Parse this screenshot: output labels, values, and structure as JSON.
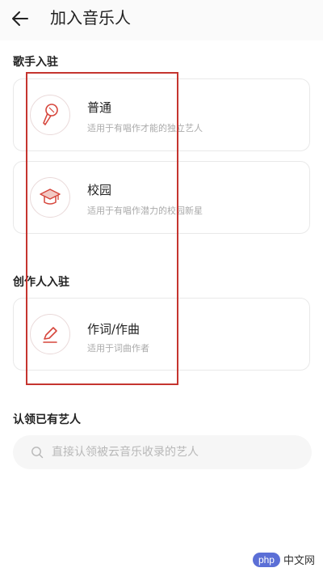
{
  "header": {
    "title": "加入音乐人",
    "back_icon": "arrow-left-icon"
  },
  "sections": [
    {
      "title": "歌手入驻",
      "cards": [
        {
          "title": "普通",
          "desc": "适用于有唱作才能的独立艺人",
          "icon": "microphone-icon"
        },
        {
          "title": "校园",
          "desc": "适用于有唱作潜力的校园新星",
          "icon": "graduation-cap-icon"
        }
      ]
    },
    {
      "title": "创作人入驻",
      "cards": [
        {
          "title": "作词/作曲",
          "desc": "适用于词曲作者",
          "icon": "pen-icon"
        }
      ]
    },
    {
      "title": "认领已有艺人"
    }
  ],
  "search": {
    "placeholder": "直接认领被云音乐收录的艺人",
    "value": ""
  },
  "watermark": {
    "badge": "php",
    "text": "中文网"
  },
  "colors": {
    "accent": "#d6463c",
    "annotation": "#c5352f",
    "card_border": "#e9e9e9",
    "muted_text": "#aaaaaa"
  }
}
